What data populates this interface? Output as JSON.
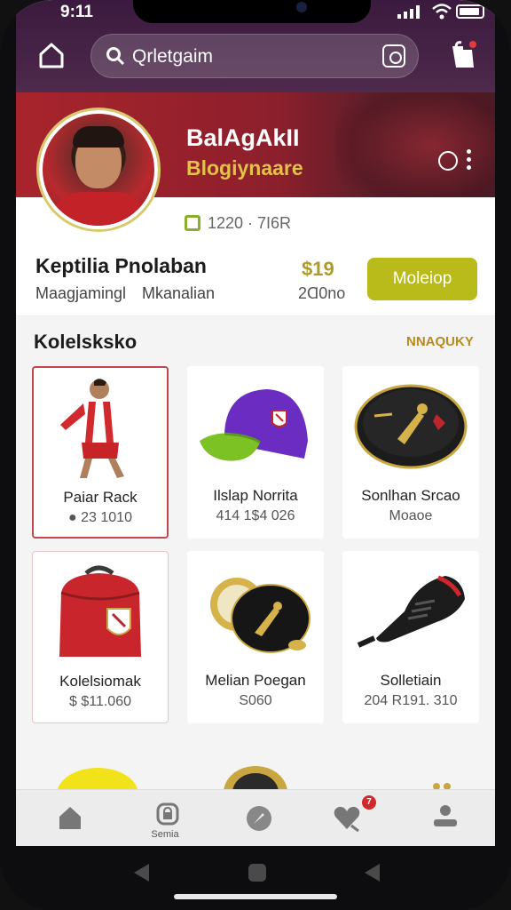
{
  "status": {
    "time": "9:11"
  },
  "search": {
    "value": "Qrletgaim"
  },
  "player": {
    "name": "BalAgAkII",
    "subtitle": "Blogiynaare",
    "stat": "1220 · 7I6R"
  },
  "info": {
    "title": "Keptilia Pnolaban",
    "meta_a": "Maagjamingl",
    "meta_b": "Mkanalian",
    "price": "$19",
    "price_sub": "2Ɑ0no",
    "button_label": "Moleiop"
  },
  "section": {
    "title": "Kolelsksko",
    "link": "NNAQUKY"
  },
  "items": [
    {
      "name": "Paiar Rack",
      "price": "● 23 1010"
    },
    {
      "name": "Ilslap Norrita",
      "price": "414 1$4 026"
    },
    {
      "name": "Sonlhan Srcao",
      "price": "Moaoe"
    },
    {
      "name": "Kolelsiomak",
      "price": "$ $11.060"
    },
    {
      "name": "Melian Poegan",
      "price": "S060"
    },
    {
      "name": "Solletiain",
      "price": "204 R191. 310"
    }
  ],
  "tabs": [
    {
      "label": ""
    },
    {
      "label": "Semia"
    },
    {
      "label": ""
    },
    {
      "label": "",
      "badge": "7"
    },
    {
      "label": ""
    }
  ],
  "colors": {
    "accent": "#b8bb1a",
    "brand": "#8c1f2c",
    "topbar": "#3a1a3e",
    "link": "#b78a1e"
  }
}
